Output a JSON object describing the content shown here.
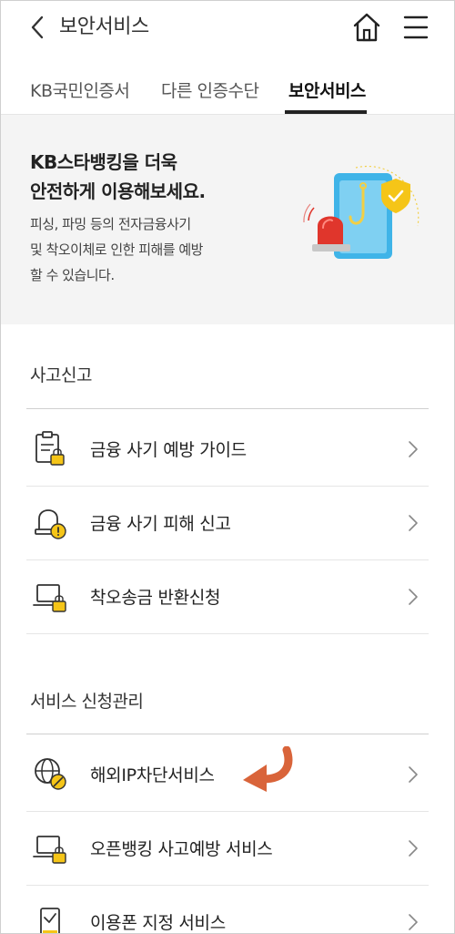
{
  "header": {
    "title": "보안서비스",
    "back_icon": "chevron-left-icon",
    "home_icon": "home-icon",
    "menu_icon": "hamburger-menu-icon"
  },
  "tabs": [
    {
      "label": "KB국민인증서",
      "active": false
    },
    {
      "label": "다른 인증수단",
      "active": false
    },
    {
      "label": "보안서비스",
      "active": true
    }
  ],
  "banner": {
    "headline_line1": "KB스타뱅킹을 더욱",
    "headline_line2": "안전하게 이용해보세요.",
    "desc_line1": "피싱, 파밍 등의 전자금융사기",
    "desc_line2": "및 착오이체로 인한 피해를 예방",
    "desc_line3": "할 수 있습니다."
  },
  "sections": [
    {
      "title": "사고신고",
      "items": [
        {
          "label": "금융 사기 예방 가이드",
          "icon": "clipboard-lock-icon"
        },
        {
          "label": "금융 사기 피해 신고",
          "icon": "siren-alert-icon"
        },
        {
          "label": "착오송금 반환신청",
          "icon": "laptop-lock-icon"
        }
      ]
    },
    {
      "title": "서비스 신청관리",
      "items": [
        {
          "label": "해외IP차단서비스",
          "icon": "globe-block-icon"
        },
        {
          "label": "오픈뱅킹 사고예방 서비스",
          "icon": "laptop-lock-icon"
        },
        {
          "label": "이용폰 지정 서비스",
          "icon": "phone-check-icon"
        }
      ]
    }
  ],
  "colors": {
    "accent_yellow": "#f5c518",
    "banner_bg": "#f4f4f4",
    "annotation_arrow": "#d9643a",
    "illust_blue": "#3fb4e8",
    "illust_red": "#e0362c"
  }
}
